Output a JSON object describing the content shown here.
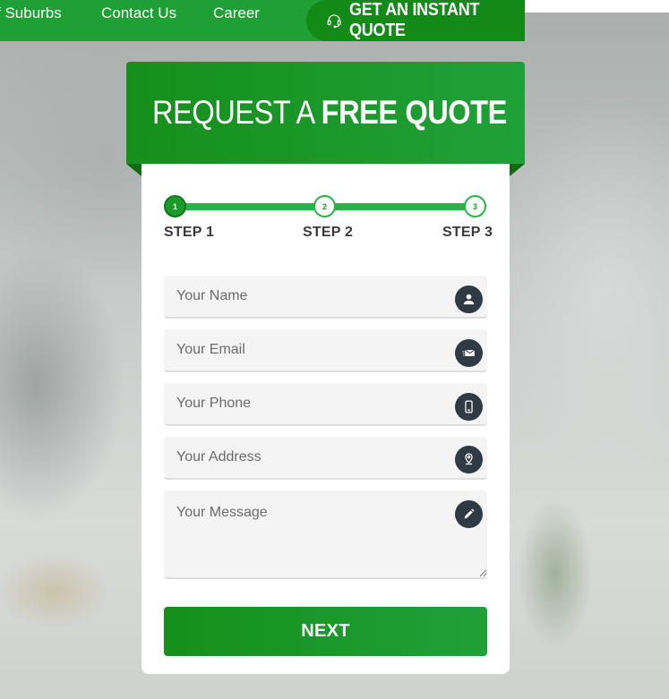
{
  "nav": {
    "links": [
      "f Suburbs",
      "Contact Us",
      "Career"
    ],
    "cta_label": "GET AN INSTANT QUOTE",
    "cta_icon": "headset-icon"
  },
  "quote_form": {
    "title_regular": "REQUEST A",
    "title_bold": "FREE QUOTE",
    "progress": {
      "current_step": 1,
      "total_steps": 3,
      "dots": [
        "1",
        "2",
        "3"
      ],
      "labels": [
        "STEP 1",
        "STEP 2",
        "STEP 3"
      ]
    },
    "fields": {
      "name": {
        "placeholder": "Your Name",
        "icon": "user-icon"
      },
      "email": {
        "placeholder": "Your Email",
        "icon": "envelope-icon"
      },
      "phone": {
        "placeholder": "Your Phone",
        "icon": "phone-icon"
      },
      "address": {
        "placeholder": "Your Address",
        "icon": "location-pin-icon"
      },
      "message": {
        "placeholder": "Your Message",
        "icon": "pencil-icon"
      }
    },
    "next_label": "NEXT"
  },
  "colors": {
    "brand_green": "#1fa035",
    "dark_green": "#138a18",
    "icon_circle": "#2f3a45"
  }
}
